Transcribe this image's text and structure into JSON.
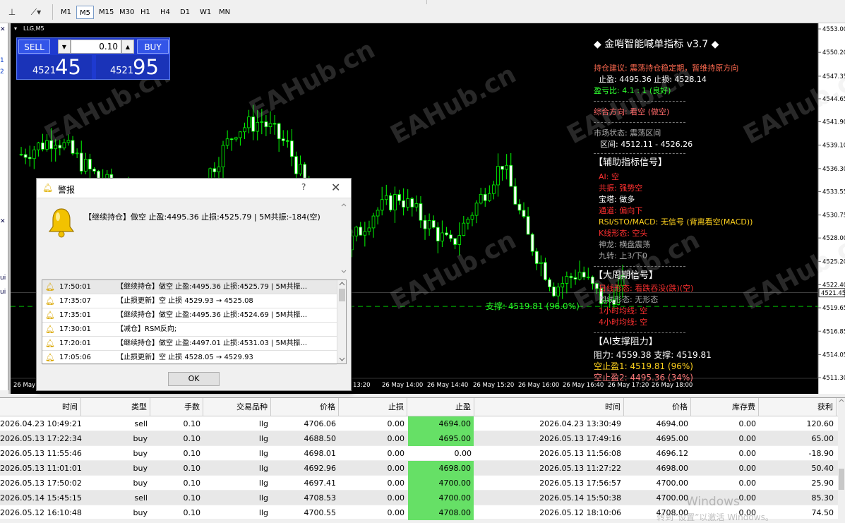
{
  "toolbar": {
    "timeframes": [
      "M1",
      "M5",
      "M15",
      "M30",
      "H1",
      "H4",
      "D1",
      "W1",
      "MN"
    ],
    "active": "M5"
  },
  "leftstrip": {
    "items": [
      "x",
      "1",
      "2",
      "x",
      "ui",
      "ui"
    ]
  },
  "chart": {
    "symbol": "LLG,M5",
    "y_ticks": [
      "4553.00",
      "4550.20",
      "4547.35",
      "4544.65",
      "4541.90",
      "4539.10",
      "4536.30",
      "4533.55",
      "4530.75",
      "4528.00",
      "4525.20",
      "4522.40",
      "4519.65",
      "4516.85",
      "4514.05",
      "4511.30"
    ],
    "current_price": "4521.45",
    "x_ticks": [
      "26 May",
      "13:20",
      "26 May 14:00",
      "26 May 14:40",
      "26 May 15:20",
      "26 May 16:00",
      "26 May 16:40",
      "26 May 17:20",
      "26 May 18:00"
    ],
    "x_tick_first": "26 May",
    "support_label": "支撑: 4519.81 (96.0%)",
    "watermark": "EAHub.cn"
  },
  "trade_panel": {
    "sell": "SELL",
    "buy": "BUY",
    "lot": "0.10",
    "sell_small": "4521",
    "sell_big": "45",
    "buy_small": "4521",
    "buy_big": "95"
  },
  "info_panel": {
    "title": "◆ 金哨智能喊单指标 v3.7 ◆",
    "advice": "持仓建议: 震荡持仓稳定期，暂维持原方向",
    "tp_sl": "止盈: 4495.36  止损: 4528.14",
    "rr": "盈亏比: 4.1 : 1 (良好)",
    "direction": "综合方向: 看空 (做空)",
    "market_state": "市场状态: 震荡区间",
    "range": "区间: 4512.11 - 4526.26",
    "aux_header": "【辅助指标信号】",
    "ai": "AI: 空",
    "resonance": "共振: 强势空",
    "tower": "宝塔: 做多",
    "channel": "通道: 偏向下",
    "rsi": "RSI/STO/MACD: 无信号 (背离看空(MACD))",
    "kline": "K线形态: 空头",
    "dragon": "神龙: 横盘震荡",
    "power": "九转: 上3/下0",
    "big_period_header": "【大周期信号】",
    "daily": "日线形态: 看跌吞没(跌)(空)",
    "weekly": "周线形态: 无形态",
    "h1": "1小时均线: 空",
    "h4": "4小时均线: 空",
    "ai_sr_header": "【AI支撑阻力】",
    "resistance": "阻力: 4559.38  支撑: 4519.81",
    "tp1": "空止盈1: 4519.81 (96%)",
    "tp2": "空止盈2: 4495.36 (34%)"
  },
  "alert": {
    "title": "警报",
    "help": "?",
    "close": "✕",
    "message": "【继续持仓】做空 止盈:4495.36 止损:4525.79 | 5M共振:-184(空)",
    "rows": [
      {
        "time": "17:50:01",
        "msg": "【继续持仓】做空 止盈:4495.36 止损:4525.79 | 5M共振..."
      },
      {
        "time": "17:35:07",
        "msg": "【止损更新】空 止损 4529.93 → 4525.08"
      },
      {
        "time": "17:35:01",
        "msg": "【继续持仓】做空 止盈:4495.36 止损:4524.69 | 5M共振..."
      },
      {
        "time": "17:30:01",
        "msg": "【减仓】RSM反向;"
      },
      {
        "time": "17:20:01",
        "msg": "【继续持仓】做空 止盈:4497.01 止损:4531.03 | 5M共振..."
      },
      {
        "time": "17:05:06",
        "msg": "【止损更新】空 止损 4528.05 → 4529.93"
      }
    ],
    "ok": "OK"
  },
  "terminal": {
    "headers": [
      "时间",
      "类型",
      "手数",
      "交易品种",
      "价格",
      "止损",
      "止盈",
      "时间",
      "价格",
      "库存费",
      "获利"
    ],
    "rows": [
      [
        "2026.04.23 10:49:21",
        "sell",
        "0.10",
        "llg",
        "4706.06",
        "0.00",
        "4694.00",
        "2026.04.23 13:30:49",
        "4694.00",
        "0.00",
        "120.60"
      ],
      [
        "2026.05.13 17:22:34",
        "buy",
        "0.10",
        "llg",
        "4688.50",
        "0.00",
        "4695.00",
        "2026.05.13 17:49:16",
        "4695.00",
        "0.00",
        "65.00"
      ],
      [
        "2026.05.13 11:55:46",
        "buy",
        "0.10",
        "llg",
        "4698.01",
        "0.00",
        "0.00",
        "2026.05.13 11:56:08",
        "4696.12",
        "0.00",
        "-18.90"
      ],
      [
        "2026.05.13 11:01:01",
        "buy",
        "0.10",
        "llg",
        "4692.96",
        "0.00",
        "4698.00",
        "2026.05.13 11:27:22",
        "4698.00",
        "0.00",
        "50.40"
      ],
      [
        "2026.05.13 17:50:02",
        "buy",
        "0.10",
        "llg",
        "4697.41",
        "0.00",
        "4700.00",
        "2026.05.13 17:56:57",
        "4700.00",
        "0.00",
        "25.90"
      ],
      [
        "2026.05.14 15:45:15",
        "sell",
        "0.10",
        "llg",
        "4708.53",
        "0.00",
        "4700.00",
        "2026.05.14 15:50:38",
        "4700.00",
        "0.00",
        "85.30"
      ],
      [
        "2026.05.12 16:10:48",
        "buy",
        "0.10",
        "llg",
        "4700.55",
        "0.00",
        "4708.00",
        "2026.05.12 18:10:06",
        "4708.00",
        "0.00",
        "74.50"
      ]
    ],
    "tp_green": [
      true,
      true,
      false,
      true,
      true,
      true,
      true
    ]
  },
  "windows_watermark": {
    "line1": "Windows",
    "line2": "转到“设置”以激活 Windows。"
  },
  "colors": {
    "bull": "#00ff00",
    "bear": "#00ff00",
    "support": "#00c000",
    "panel": "#1e3ad0"
  }
}
